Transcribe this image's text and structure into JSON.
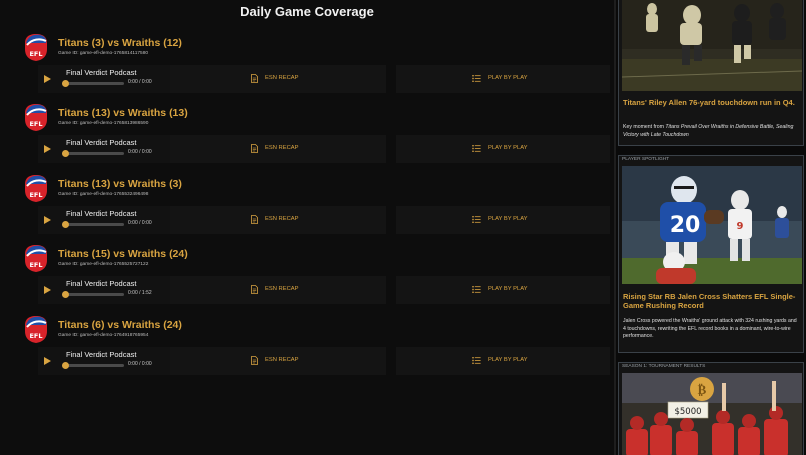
{
  "page_title": "Daily Game Coverage",
  "podcast_title": "Final Verdict Podcast",
  "recap_label": "ESN RECAP",
  "pbp_label": "PLAY BY PLAY",
  "logo_text": "EFL",
  "colors": {
    "accent": "#d9a441",
    "bg": "#0d0d0d",
    "card_border": "#3a4148"
  },
  "games": [
    {
      "matchup": "Titans (3) vs Wraiths (12)",
      "game_id": "Game ID: game-efl-demo-1765814117580",
      "time": "0:00 / 0:00",
      "progress": 0
    },
    {
      "matchup": "Titans (13) vs Wraiths (13)",
      "game_id": "Game ID: game-efl-demo-1765813986590",
      "time": "0:00 / 0:00",
      "progress": 0
    },
    {
      "matchup": "Titans (13) vs Wraiths (3)",
      "game_id": "Game ID: game-efl-demo-1765532496498",
      "time": "0:00 / 0:00",
      "progress": 0
    },
    {
      "matchup": "Titans (15) vs Wraiths (24)",
      "game_id": "Game ID: game-efl-demo-1765525727122",
      "time": "0:00 / 1:52",
      "progress": 0
    },
    {
      "matchup": "Titans (6) vs Wraiths (24)",
      "game_id": "Game ID: game-efl-demo-1764918765954",
      "time": "0:00 / 0:00",
      "progress": 0
    }
  ],
  "sidebar": {
    "card1": {
      "title": "Titans' Riley Allen 76-yard touchdown run in Q4.",
      "desc_prefix": "Key moment from ",
      "desc_italic": "Titans Prevail Over Wraiths in Defensive Battle, Sealing Victory with Late Touchdown"
    },
    "card2": {
      "label": "PLAYER SPOTLIGHT",
      "title": "Rising Star RB Jalen Cross Shatters EFL Single-Game Rushing Record",
      "desc": "Jalen Cross powered the Wraiths' ground attack with 324 rushing yards and 4 touchdowns, rewriting the EFL record books in a dominant, wire-to-wire performance.",
      "jersey_front": "20",
      "jersey_back": "9"
    },
    "card3": {
      "label": "SEASON 1: TOURNAMENT RESULTS",
      "check_text": "$5000"
    }
  }
}
